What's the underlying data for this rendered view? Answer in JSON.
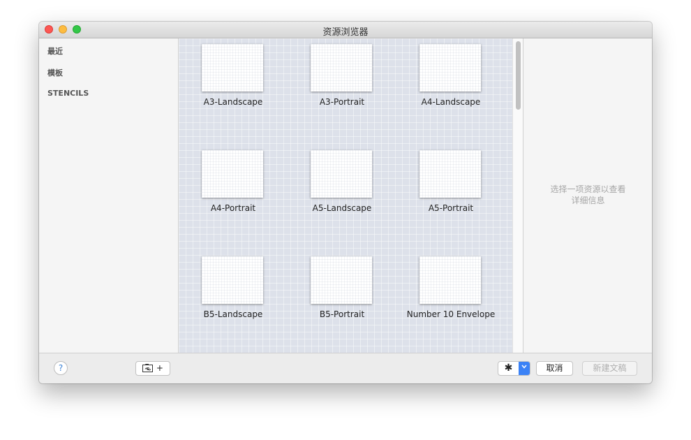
{
  "window": {
    "title": "资源浏览器"
  },
  "sidebar": {
    "items": [
      {
        "label": "最近"
      },
      {
        "label": "模板"
      },
      {
        "label": "STENCILS"
      }
    ]
  },
  "templates": [
    {
      "label": "A3-Landscape"
    },
    {
      "label": "A3-Portrait"
    },
    {
      "label": "A4-Landscape"
    },
    {
      "label": "A4-Portrait"
    },
    {
      "label": "A5-Landscape"
    },
    {
      "label": "A5-Portrait"
    },
    {
      "label": "B5-Landscape"
    },
    {
      "label": "B5-Portrait"
    },
    {
      "label": "Number 10 Envelope"
    }
  ],
  "details": {
    "placeholder_line1": "选择一项资源以查看",
    "placeholder_line2": "详细信息"
  },
  "footer": {
    "help_label": "?",
    "add_resource_label": "+",
    "gear_label": "✱",
    "cancel_label": "取消",
    "new_document_label": "新建文稿"
  },
  "colors": {
    "accent": "#3b82f6",
    "grid_background": "#dde1ea"
  }
}
